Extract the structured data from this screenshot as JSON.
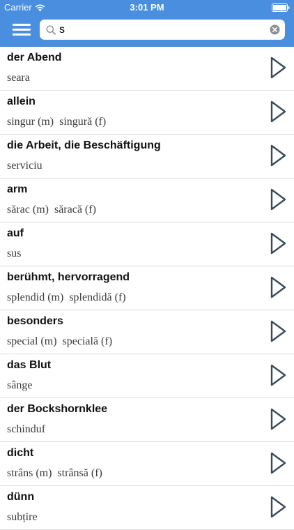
{
  "status_bar": {
    "carrier": "Carrier",
    "time": "3:01 PM",
    "icons": [
      "wifi-icon",
      "battery-icon"
    ]
  },
  "nav_bar": {
    "menu_icon": "hamburger-menu-icon",
    "search": {
      "icon": "search-icon",
      "value": "s",
      "clear_icon": "clear-icon"
    }
  },
  "words": [
    {
      "german": "der Abend",
      "romanian": "seara"
    },
    {
      "german": "allein",
      "romanian": "singur (m)  singură (f)"
    },
    {
      "german": "die Arbeit, die Beschäftigung",
      "romanian": "serviciu"
    },
    {
      "german": "arm",
      "romanian": "sărac (m)  săracă (f)"
    },
    {
      "german": "auf",
      "romanian": "sus"
    },
    {
      "german": "berühmt, hervorragend",
      "romanian": "splendid (m)  splendidă (f)"
    },
    {
      "german": "besonders",
      "romanian": "special (m)  specială (f)"
    },
    {
      "german": "das Blut",
      "romanian": "sânge"
    },
    {
      "german": "der Bockshornklee",
      "romanian": "schinduf"
    },
    {
      "german": "dicht",
      "romanian": "strâns (m)  strânsă (f)"
    },
    {
      "german": "dünn",
      "romanian": "subțire"
    }
  ],
  "row_icon": "play-icon",
  "colors": {
    "nav_bar": "#4a8ee0",
    "play_icon": "#3a4a5a",
    "divider": "#dcdcdc"
  }
}
